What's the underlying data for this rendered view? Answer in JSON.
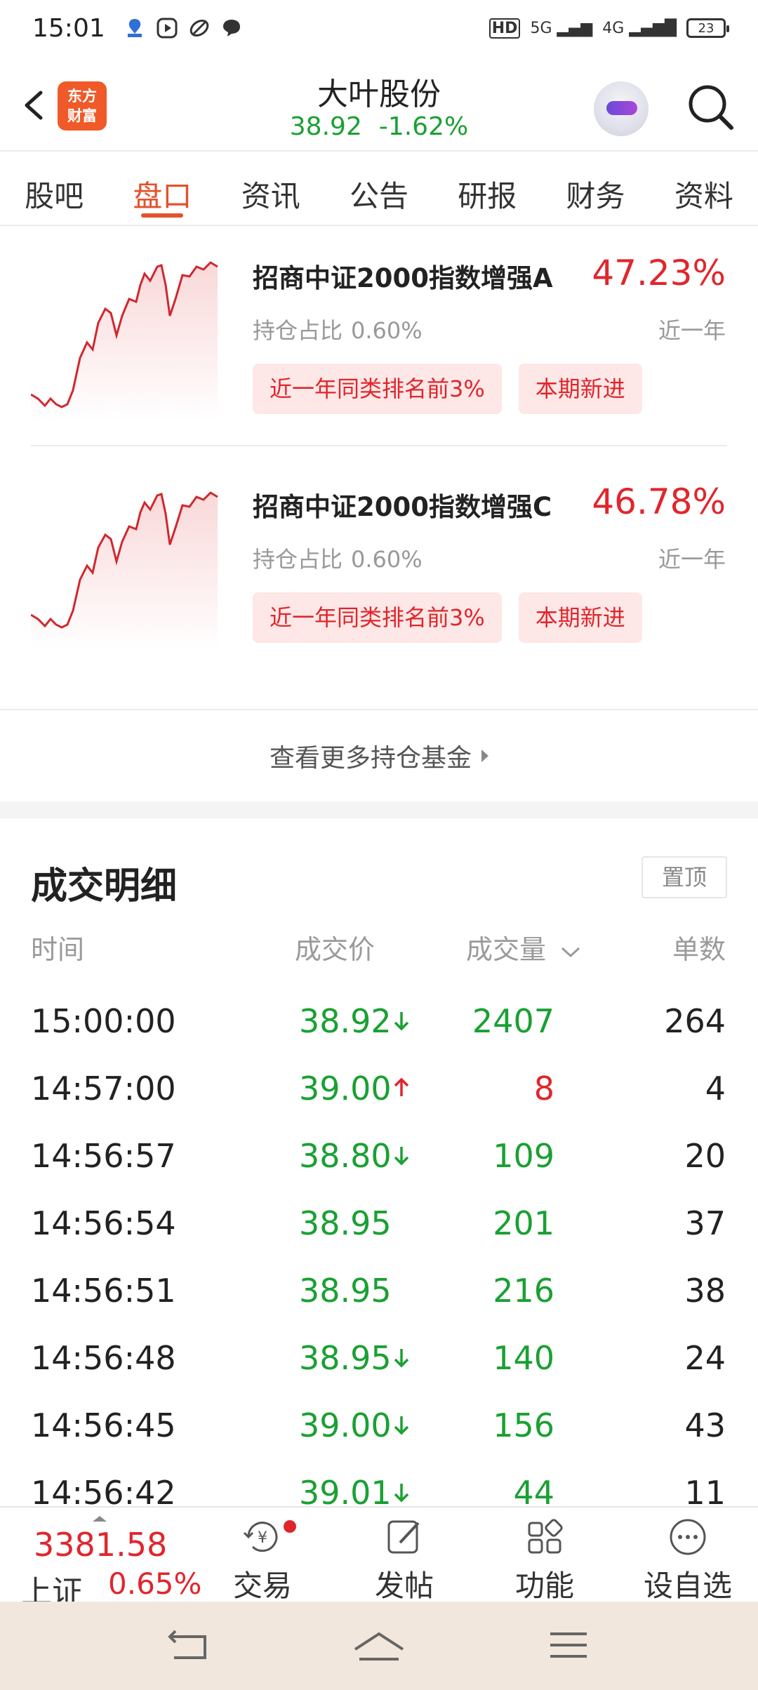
{
  "status_bar": {
    "time": "15:01",
    "signal_1": "5G",
    "signal_2": "4G",
    "hd": "HD",
    "battery": "23"
  },
  "header": {
    "logo_text_1": "东方",
    "logo_text_2": "财富",
    "stock_name": "大叶股份",
    "price": "38.92",
    "change_pct": "-1.62%"
  },
  "tabs": [
    {
      "label": "股吧"
    },
    {
      "label": "盘口"
    },
    {
      "label": "资讯"
    },
    {
      "label": "公告"
    },
    {
      "label": "研报"
    },
    {
      "label": "财务"
    },
    {
      "label": "资料"
    }
  ],
  "funds": [
    {
      "name": "招商中证2000指数增强A",
      "return": "47.23%",
      "holding_label": "持仓占比",
      "holding_value": "0.60%",
      "period": "近一年",
      "tags": [
        "近一年同类排名前3%",
        "本期新进"
      ]
    },
    {
      "name": "招商中证2000指数增强C",
      "return": "46.78%",
      "holding_label": "持仓占比",
      "holding_value": "0.60%",
      "period": "近一年",
      "tags": [
        "近一年同类排名前3%",
        "本期新进"
      ]
    }
  ],
  "more_funds_label": "查看更多持仓基金",
  "trades": {
    "title": "成交明细",
    "pin_label": "置顶",
    "columns": {
      "time": "时间",
      "price": "成交价",
      "volume": "成交量",
      "count": "单数"
    },
    "rows": [
      {
        "time": "15:00:00",
        "price": "38.92",
        "dir": "down",
        "volume": "2407",
        "vol_color": "green",
        "count": "264"
      },
      {
        "time": "14:57:00",
        "price": "39.00",
        "dir": "up",
        "volume": "8",
        "vol_color": "red",
        "count": "4"
      },
      {
        "time": "14:56:57",
        "price": "38.80",
        "dir": "down",
        "volume": "109",
        "vol_color": "green",
        "count": "20"
      },
      {
        "time": "14:56:54",
        "price": "38.95",
        "dir": "none",
        "volume": "201",
        "vol_color": "green",
        "count": "37"
      },
      {
        "time": "14:56:51",
        "price": "38.95",
        "dir": "none",
        "volume": "216",
        "vol_color": "green",
        "count": "38"
      },
      {
        "time": "14:56:48",
        "price": "38.95",
        "dir": "down",
        "volume": "140",
        "vol_color": "green",
        "count": "24"
      },
      {
        "time": "14:56:45",
        "price": "39.00",
        "dir": "down",
        "volume": "156",
        "vol_color": "green",
        "count": "43"
      },
      {
        "time": "14:56:42",
        "price": "39.01",
        "dir": "down",
        "volume": "44",
        "vol_color": "green",
        "count": "11"
      }
    ]
  },
  "bottom_nav": {
    "index_price": "3381.58",
    "index_name": "上证",
    "index_pct": "0.65%",
    "items": [
      {
        "label": "交易",
        "icon": "trade-yen-icon"
      },
      {
        "label": "发帖",
        "icon": "edit-post-icon"
      },
      {
        "label": "功能",
        "icon": "grid-functions-icon"
      },
      {
        "label": "设自选",
        "icon": "more-dots-icon"
      }
    ]
  },
  "colors": {
    "up_red": "#e0262c",
    "down_green": "#1aa033",
    "accent_orange": "#e2532c",
    "tag_bg": "#fde8e7"
  }
}
